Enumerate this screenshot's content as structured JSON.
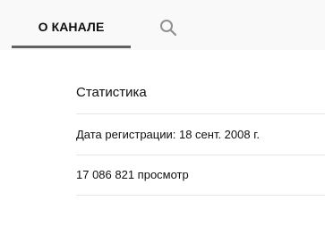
{
  "tabs": {
    "about_label": "О КАНАЛЕ",
    "search_icon": "search-icon"
  },
  "stats": {
    "title": "Статистика",
    "joined": "Дата регистрации: 18 сент. 2008 г.",
    "views": "17 086 821 просмотр"
  },
  "colors": {
    "tab_bar_bg": "#f9f9f9",
    "tab_underline": "#606060",
    "icon": "#909090",
    "divider": "#e5e5e5",
    "text": "#0f0f0f"
  }
}
